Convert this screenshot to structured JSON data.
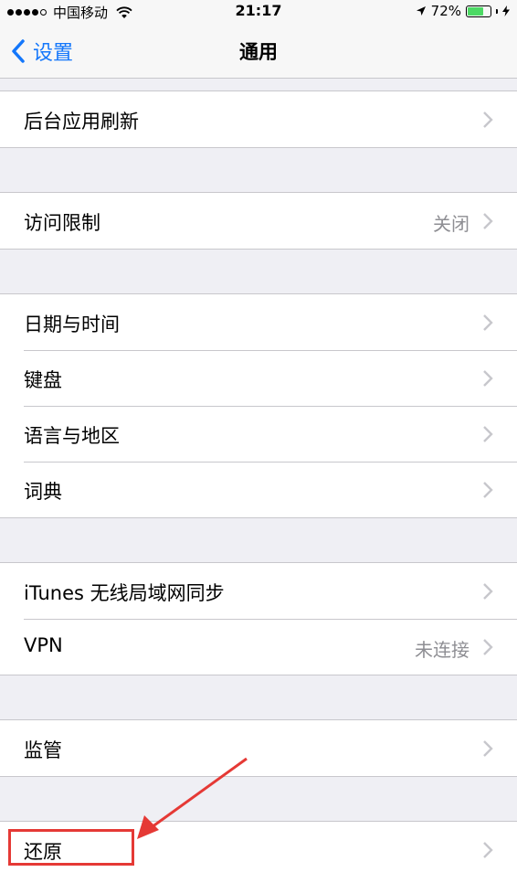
{
  "status_bar": {
    "carrier": "中国移动",
    "time": "21:17",
    "battery_percent": "72%",
    "battery_level": 0.72,
    "signal_bars_filled": 4,
    "signal_bars_total": 5,
    "battery_color": "#4cd964"
  },
  "nav": {
    "back_label": "设置",
    "title": "通用",
    "accent_color": "#1477fb"
  },
  "groups": [
    {
      "rows": [
        {
          "label": "后台应用刷新",
          "value": ""
        }
      ]
    },
    {
      "rows": [
        {
          "label": "访问限制",
          "value": "关闭"
        }
      ]
    },
    {
      "rows": [
        {
          "label": "日期与时间",
          "value": ""
        },
        {
          "label": "键盘",
          "value": ""
        },
        {
          "label": "语言与地区",
          "value": ""
        },
        {
          "label": "词典",
          "value": ""
        }
      ]
    },
    {
      "rows": [
        {
          "label": "iTunes 无线局域网同步",
          "value": ""
        },
        {
          "label": "VPN",
          "value": "未连接"
        }
      ]
    },
    {
      "rows": [
        {
          "label": "监管",
          "value": ""
        }
      ]
    },
    {
      "rows": [
        {
          "label": "还原",
          "value": ""
        }
      ]
    }
  ],
  "annotation": {
    "highlight_color": "#e53935",
    "target": "还原"
  }
}
